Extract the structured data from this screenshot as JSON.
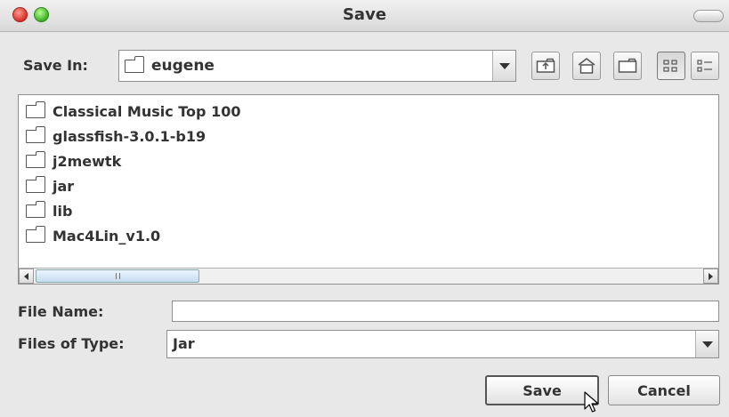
{
  "window": {
    "title": "Save"
  },
  "save_in": {
    "label": "Save In:",
    "value": "eugene"
  },
  "toolbar": {
    "icons": [
      "up-one-level-icon",
      "home-icon",
      "new-folder-icon",
      "list-view-icon",
      "details-view-icon"
    ]
  },
  "file_list": {
    "items": [
      {
        "label": "Classical Music Top 100",
        "icon": "folder-icon"
      },
      {
        "label": "glassfish-3.0.1-b19",
        "icon": "folder-icon"
      },
      {
        "label": "j2mewtk",
        "icon": "folder-icon"
      },
      {
        "label": "jar",
        "icon": "folder-icon"
      },
      {
        "label": "lib",
        "icon": "folder-icon"
      },
      {
        "label": "Mac4Lin_v1.0",
        "icon": "folder-icon"
      }
    ]
  },
  "file_name": {
    "label": "File Name:",
    "value": ""
  },
  "files_of_type": {
    "label": "Files of Type:",
    "value": "Jar"
  },
  "buttons": {
    "save": "Save",
    "cancel": "Cancel"
  }
}
